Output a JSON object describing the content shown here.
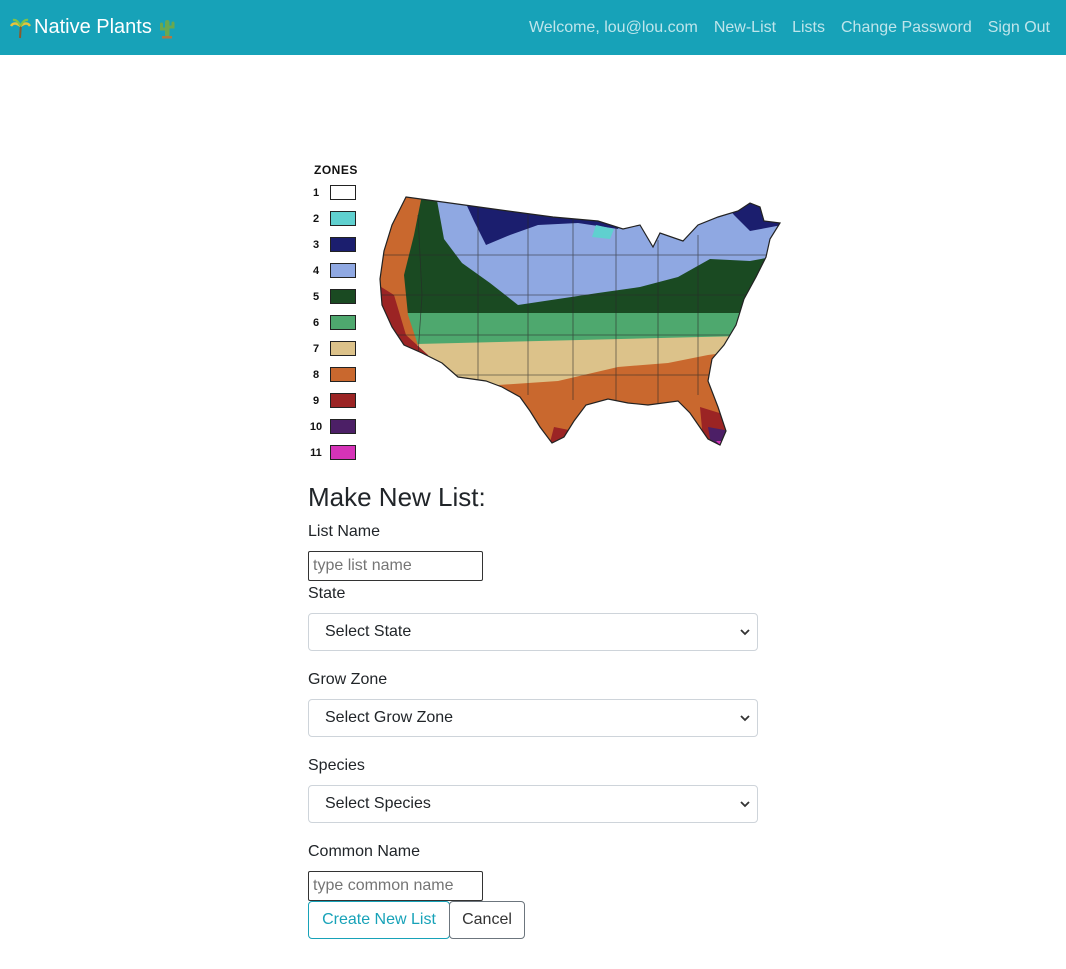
{
  "nav": {
    "brand": "Native Plants",
    "brand_icon_left": "palm-icon",
    "brand_icon_right": "cactus-icon",
    "links": [
      "Welcome, lou@lou.com",
      "New-List",
      "Lists",
      "Change Password",
      "Sign Out"
    ]
  },
  "map": {
    "legend_title": "ZONES",
    "zones": [
      {
        "number": "1",
        "color": "#ffffff"
      },
      {
        "number": "2",
        "color": "#5fd0cf"
      },
      {
        "number": "3",
        "color": "#1b1e6e"
      },
      {
        "number": "4",
        "color": "#8fa8e2"
      },
      {
        "number": "5",
        "color": "#1a4a22"
      },
      {
        "number": "6",
        "color": "#4ea86e"
      },
      {
        "number": "7",
        "color": "#dcc28a"
      },
      {
        "number": "8",
        "color": "#c9682e"
      },
      {
        "number": "9",
        "color": "#9b2424"
      },
      {
        "number": "10",
        "color": "#4c1f66"
      },
      {
        "number": "11",
        "color": "#d633b8"
      }
    ]
  },
  "form": {
    "title": "Make New List:",
    "list_name_label": "List Name",
    "list_name_placeholder": "type list name",
    "state_label": "State",
    "state_value": "Select State",
    "zone_label": "Grow Zone",
    "zone_value": "Select Grow Zone",
    "species_label": "Species",
    "species_value": "Select Species",
    "common_name_label": "Common Name",
    "common_name_placeholder": "type common name",
    "create_button": "Create New List",
    "cancel_button": "Cancel"
  },
  "colors": {
    "navbar": "#17a2b8",
    "accent": "#17a2b8"
  }
}
